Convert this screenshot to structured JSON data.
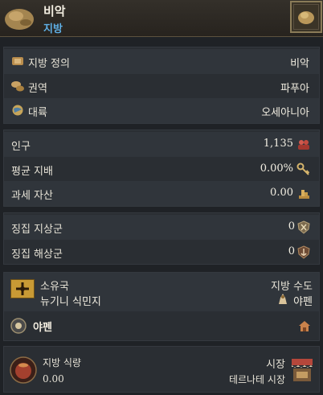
{
  "header": {
    "title": "비악",
    "subtitle": "지방"
  },
  "region_info": {
    "rows": [
      {
        "label": "지방 정의",
        "value": "비악",
        "icon": "province-scroll-icon"
      },
      {
        "label": "권역",
        "value": "파푸아",
        "icon": "area-map-icon"
      },
      {
        "label": "대륙",
        "value": "오세아니아",
        "icon": "globe-icon"
      }
    ]
  },
  "stats": {
    "population_label": "인구",
    "population_value": "1,135",
    "population_icon": "population-icon",
    "control_label": "평균 지배",
    "control_value": "0.00%",
    "control_icon": "key-icon",
    "tax_label": "과세 자산",
    "tax_value": "0.00",
    "tax_icon": "coins-icon"
  },
  "recruit": {
    "army_label": "징집 지상군",
    "army_value": "0",
    "army_icon": "army-shield-icon",
    "navy_label": "징집 해상군",
    "navy_value": "0",
    "navy_icon": "navy-shield-icon"
  },
  "ownership": {
    "owner_label": "소유국",
    "owner_value": "뉴기니 식민지",
    "capital_label": "지방 수도",
    "capital_value": "야펜",
    "location_name": "야펜",
    "flag_icon": "country-flag-icon",
    "capital_icon": "capital-icon",
    "location_icon": "location-icon",
    "home_icon": "home-icon"
  },
  "food": {
    "label": "지방 식량",
    "value": "0.00",
    "market_label": "시장",
    "market_value": "테르나테 시장",
    "food_icon": "food-pot-icon",
    "market_icon": "market-stall-icon"
  },
  "colors": {
    "background": "#1f2226",
    "panel": "#2a2e33",
    "row_alt": "#30353b",
    "subtitle_blue": "#5fb0e6",
    "gold": "#c89a35"
  }
}
